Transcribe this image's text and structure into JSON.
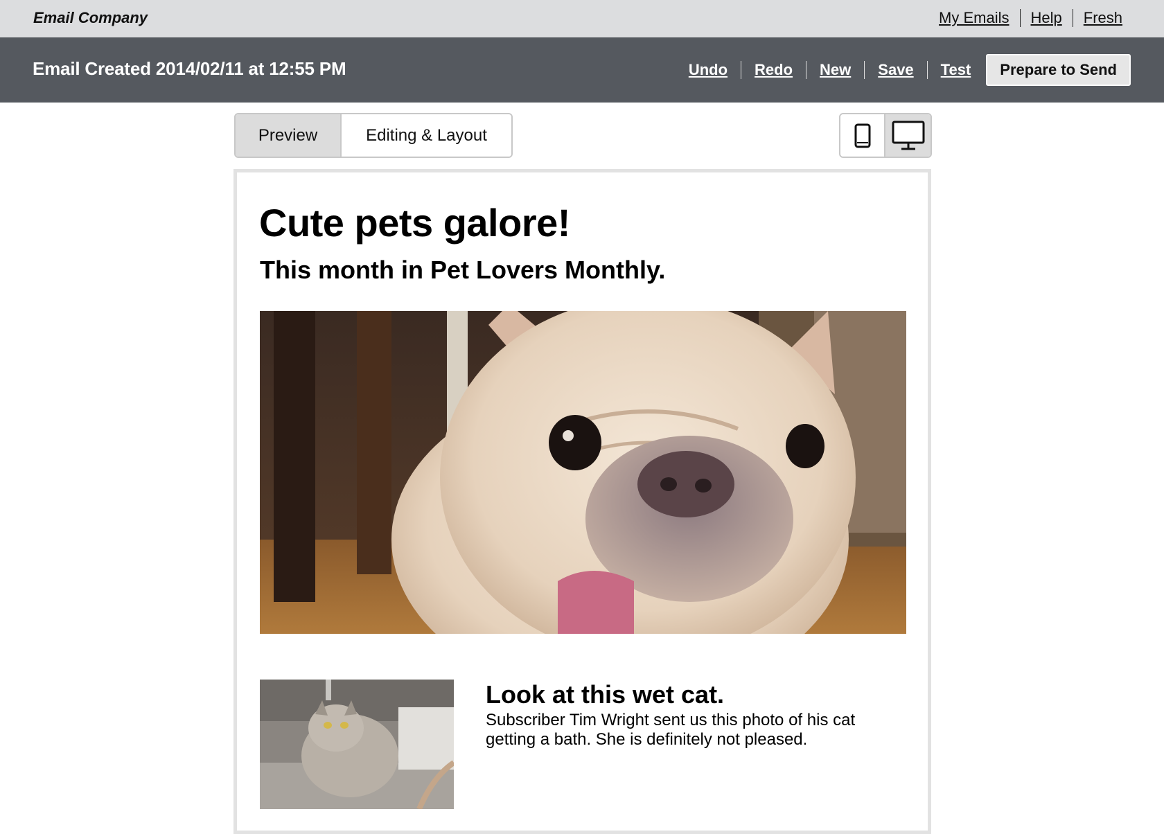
{
  "topbar": {
    "brand": "Email Company",
    "links": [
      "My Emails",
      "Help",
      "Fresh"
    ]
  },
  "toolbar": {
    "title": "Email Created 2014/02/11 at 12:55 PM",
    "actions": [
      "Undo",
      "Redo",
      "New",
      "Save",
      "Test"
    ],
    "send_label": "Prepare to Send"
  },
  "view": {
    "tabs": [
      {
        "label": "Preview",
        "active": true
      },
      {
        "label": "Editing & Layout",
        "active": false
      }
    ],
    "devices": [
      {
        "icon": "mobile-phone-icon",
        "active": false
      },
      {
        "icon": "desktop-monitor-icon",
        "active": true
      }
    ]
  },
  "email": {
    "title": "Cute pets galore!",
    "subtitle": "This month in Pet Lovers Monthly.",
    "story": {
      "title": "Look at this wet cat.",
      "body": "Subscriber Tim Wright sent us this photo of his cat getting a bath. She is definitely not pleased."
    }
  },
  "colors": {
    "topbar_bg": "#dcdddf",
    "toolbar_bg": "#55595f",
    "active_tab_bg": "#dcdcdc",
    "frame_border": "#e2e2e2"
  }
}
